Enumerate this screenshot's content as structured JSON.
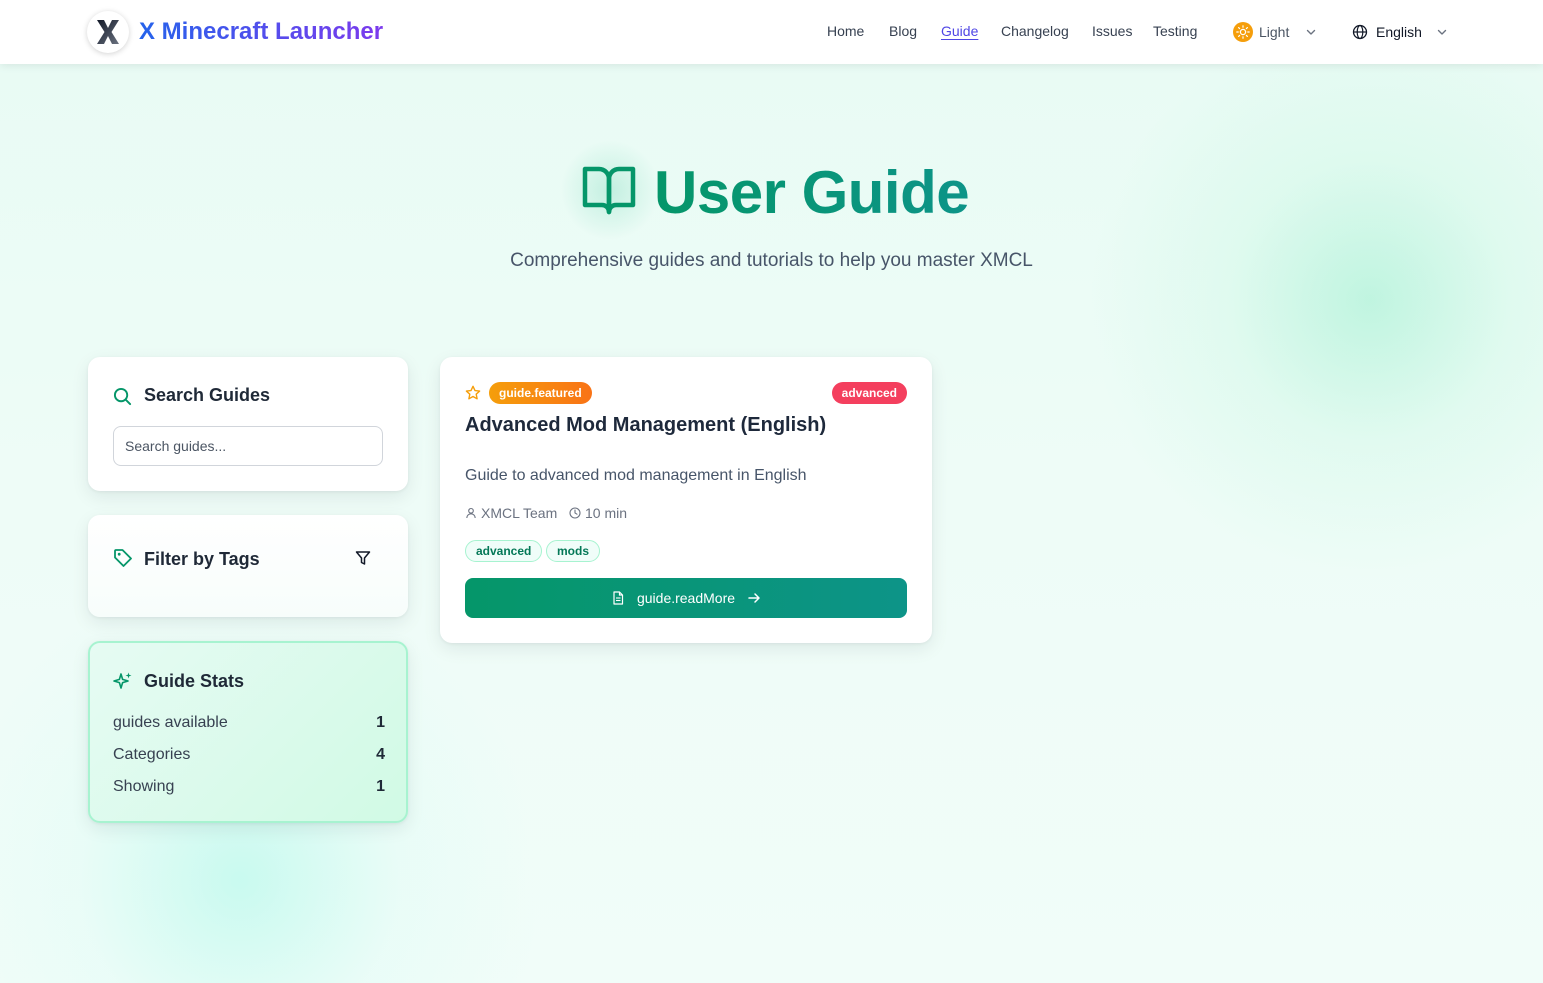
{
  "header": {
    "app_title": "X Minecraft Launcher",
    "logo_letter": "X",
    "nav": [
      {
        "label": "Home",
        "active": false
      },
      {
        "label": "Blog",
        "active": false
      },
      {
        "label": "Guide",
        "active": true
      },
      {
        "label": "Changelog",
        "active": false
      },
      {
        "label": "Issues",
        "active": false
      },
      {
        "label": "Testing",
        "active": false
      }
    ],
    "theme_label": "Light",
    "language_label": "English"
  },
  "hero": {
    "title": "User Guide",
    "subtitle": "Comprehensive guides and tutorials to help you master XMCL"
  },
  "sidebar": {
    "search": {
      "title": "Search Guides",
      "placeholder": "Search guides..."
    },
    "filter": {
      "title": "Filter by Tags"
    },
    "stats": {
      "title": "Guide Stats",
      "rows": [
        {
          "label": "guides available",
          "value": "1"
        },
        {
          "label": "Categories",
          "value": "4"
        },
        {
          "label": "Showing",
          "value": "1"
        }
      ]
    }
  },
  "guides": [
    {
      "featured_badge": "guide.featured",
      "level_badge": "advanced",
      "title": "Advanced Mod Management (English)",
      "description": "Guide to advanced mod management in English",
      "author": "XMCL Team",
      "read_time": "10 min",
      "tags": [
        "advanced",
        "mods"
      ],
      "read_more_label": "guide.readMore"
    }
  ],
  "colors": {
    "accent": "#059669",
    "teal": "#0d9488",
    "featured": "#f59e0b",
    "level_advanced": "#f43f5e",
    "brand_gradient_start": "#2563eb",
    "brand_gradient_end": "#7c3aed"
  }
}
